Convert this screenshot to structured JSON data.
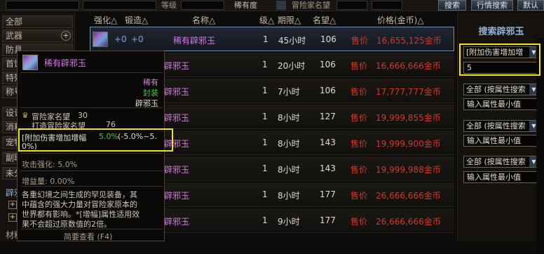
{
  "topbar": {
    "grade_label": "等级",
    "rarity_value": "稀有度",
    "fame_label": "冒险家名望",
    "search_button": "搜索",
    "detailed_search_button": "行情搜索",
    "default_button": "默认"
  },
  "sidebar": {
    "categories": [
      {
        "label": "全部"
      },
      {
        "label": "武器"
      },
      {
        "label": "防具"
      },
      {
        "label": "首饰"
      },
      {
        "label": "特殊"
      },
      {
        "label": "称号"
      },
      {
        "label": "设计"
      },
      {
        "label": "消耗"
      },
      {
        "label": "宠物"
      },
      {
        "label": "副职"
      },
      {
        "label": "未分"
      }
    ],
    "sub_header": "辟邪",
    "sub_items": [
      {
        "label": "+"
      },
      {
        "label": "+"
      }
    ],
    "bottom": "材料"
  },
  "table": {
    "headers": {
      "upgrade": "强化△",
      "forge": "锻造△",
      "name": "名称△",
      "level": "级△",
      "period": "期限△",
      "fame": "名望△",
      "price": "价格(金币)△"
    },
    "rows": [
      {
        "up": "+0",
        "forge": "+0",
        "name": "稀有辟邪玉",
        "lv": "1",
        "period": "45小时",
        "fame": "106",
        "sell": "售价",
        "price": "16,655,125金币"
      },
      {
        "name": "辟邪玉",
        "lv": "1",
        "period": "20小时",
        "fame": "106",
        "sell": "售价",
        "price": "16,666,666金币"
      },
      {
        "name": "辟邪玉",
        "lv": "1",
        "period": "7小时",
        "fame": "106",
        "sell": "售价",
        "price": "17,777,777金币"
      },
      {
        "name": "辟邪玉",
        "lv": "1",
        "period": "8小时",
        "fame": "127",
        "sell": "售价",
        "price": "19,999,855金币"
      },
      {
        "name": "辟邪玉",
        "lv": "1",
        "period": "8小时",
        "fame": "143",
        "sell": "售价",
        "price": "19,999,900金币"
      },
      {
        "name": "辟邪玉",
        "lv": "1",
        "period": "8小时",
        "fame": "143",
        "sell": "售价",
        "price": "19,999,988金币"
      },
      {
        "name": "辟邪玉",
        "lv": "1",
        "period": "8小时",
        "fame": "177",
        "sell": "售价",
        "price": "26,666,666金币"
      },
      {
        "name": "辟邪玉",
        "lv": "1",
        "period": "9小时",
        "fame": "177",
        "sell": "售价",
        "price": "26,666,666金币"
      }
    ]
  },
  "tooltip": {
    "title": "稀有辟邪玉",
    "rarity": "稀有",
    "sealed": "封装",
    "type": "辟邪玉",
    "fame_label": "冒险家名望",
    "fame_value": "30",
    "forge_label": "打造冒险家名望",
    "forge_value": "76",
    "stat_name": "[附加伤害增加增幅",
    "stat_value": "5.0%",
    "stat_range": "(-5.0%~5.",
    "stat_range2": "0%)",
    "attack_label": "攻击强化: 5.0%",
    "gain_label": "增益量: 0.00%",
    "desc1": "各重幻境之间生成的罕见装备，其",
    "desc2": "中蕴含的强大力量对冒险家原本的",
    "desc3": "世界都有影响。*[增幅]属性适用效",
    "desc4": "果不会超过原数值的2倍。",
    "footer": "简要查看 (F4)"
  },
  "rpanel": {
    "title": "搜索辟邪玉",
    "filter1": "[附加伤害增加增",
    "filter1_value": "5",
    "filter2": "全部 (按属性搜索",
    "placeholder2": "输入属性最小值",
    "filter3": "全部 (按属性搜索",
    "placeholder3": "输入属性最小值",
    "filter4": "全部 (按属性搜索",
    "placeholder4": "输入属性最小值"
  },
  "colors": {
    "highlight": "#f2e21a",
    "price": "#d03a2a",
    "name": "#d07ae0"
  }
}
